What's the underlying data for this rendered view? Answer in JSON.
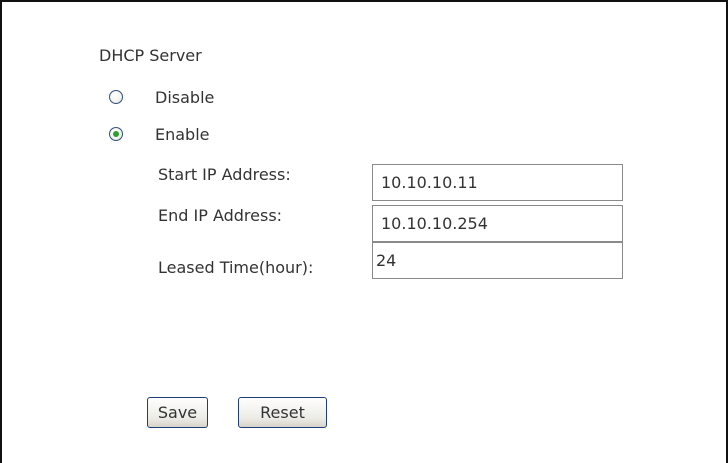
{
  "dhcp": {
    "title": "DHCP Server",
    "options": {
      "disable_label": "Disable",
      "enable_label": "Enable",
      "selected": "Enable"
    },
    "fields": {
      "start_ip_label": "Start IP Address:",
      "start_ip_value": "10.10.10.11",
      "end_ip_label": "End IP Address:",
      "end_ip_value": "10.10.10.254",
      "lease_label": "Leased Time(hour):",
      "lease_value": "24"
    }
  },
  "buttons": {
    "save_label": "Save",
    "reset_label": "Reset"
  }
}
